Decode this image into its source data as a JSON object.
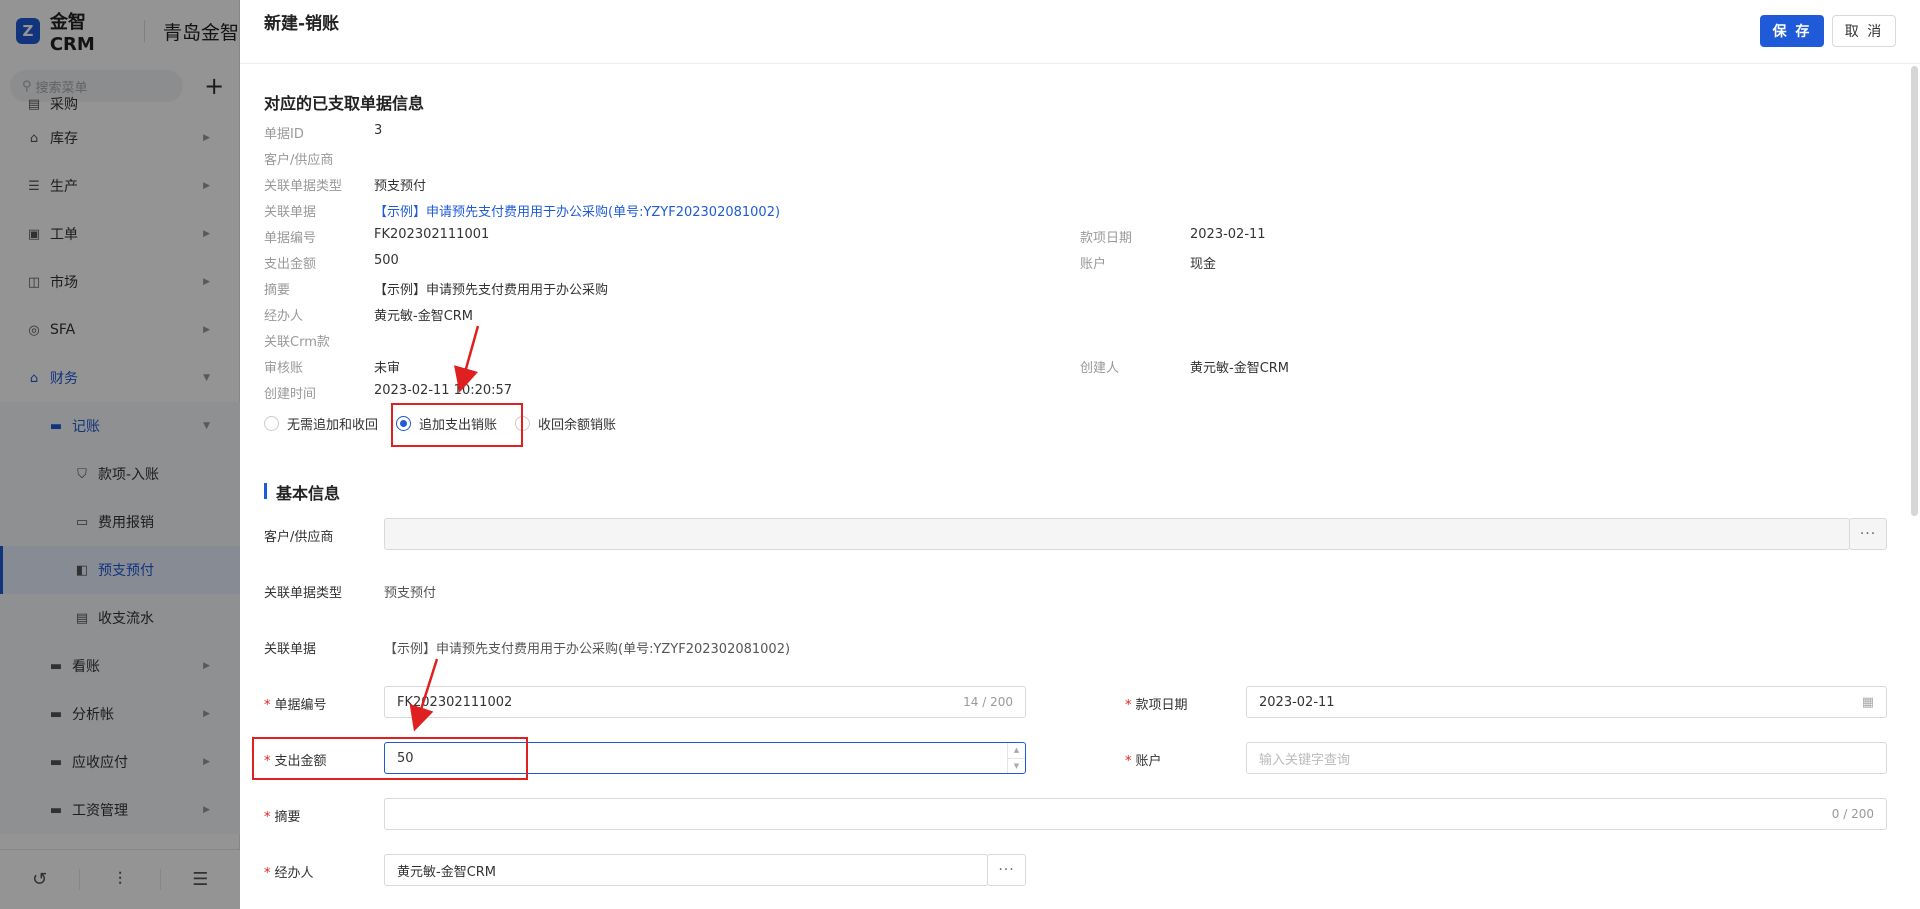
{
  "sidebar": {
    "brand": "金智CRM",
    "company": "青岛金智",
    "search_placeholder": "搜索菜单",
    "menu": [
      {
        "label": "采购",
        "icon": "cart-icon"
      },
      {
        "label": "库存",
        "icon": "warehouse-icon"
      },
      {
        "label": "生产",
        "icon": "production-icon"
      },
      {
        "label": "工单",
        "icon": "workorder-icon"
      },
      {
        "label": "市场",
        "icon": "market-icon"
      },
      {
        "label": "SFA",
        "icon": "sfa-icon"
      },
      {
        "label": "财务",
        "icon": "finance-icon"
      },
      {
        "label": "记账",
        "icon": "folder-icon"
      },
      {
        "label": "款项-入账",
        "icon": "payment-in-icon"
      },
      {
        "label": "费用报销",
        "icon": "expense-icon"
      },
      {
        "label": "预支预付",
        "icon": "prepay-icon"
      },
      {
        "label": "收支流水",
        "icon": "flow-icon"
      },
      {
        "label": "看账",
        "icon": "folder-icon"
      },
      {
        "label": "分析帐",
        "icon": "folder-icon"
      },
      {
        "label": "应收应付",
        "icon": "folder-icon"
      },
      {
        "label": "工资管理",
        "icon": "folder-icon"
      }
    ]
  },
  "drawer": {
    "title": "新建-销账",
    "save_label": "保 存",
    "cancel_label": "取 消"
  },
  "related_info": {
    "title": "对应的已支取单据信息",
    "labels": {
      "doc_id": "单据ID",
      "customer": "客户/供应商",
      "doc_type": "关联单据类型",
      "related_doc": "关联单据",
      "doc_no": "单据编号",
      "amount": "支出金额",
      "summary": "摘要",
      "handler": "经办人",
      "crm_fund": "关联Crm款",
      "audit": "审核账",
      "created_at": "创建时间",
      "fund_date": "款项日期",
      "account": "账户",
      "creator": "创建人"
    },
    "values": {
      "doc_id": "3",
      "doc_type": "预支预付",
      "related_doc": "【示例】申请预先支付费用用于办公采购(单号:YZYF202302081002)",
      "doc_no": "FK202302111001",
      "amount": "500",
      "summary": "【示例】申请预先支付费用用于办公采购",
      "handler": "黄元敏-金智CRM",
      "audit": "未审",
      "created_at": "2023-02-11 10:20:57",
      "fund_date": "2023-02-11",
      "account": "现金",
      "creator": "黄元敏-金智CRM"
    }
  },
  "options": {
    "items": [
      "无需追加和收回",
      "追加支出销账",
      "收回余额销账"
    ],
    "selected": "追加支出销账"
  },
  "basic_info": {
    "title": "基本信息",
    "labels": {
      "customer": "客户/供应商",
      "doc_type": "关联单据类型",
      "related_doc": "关联单据",
      "doc_no": "单据编号",
      "amount": "支出金额",
      "summary": "摘要",
      "handler": "经办人",
      "fund_date": "款项日期",
      "account": "账户"
    },
    "required_mark": "*",
    "values": {
      "doc_type": "预支预付",
      "related_doc": "【示例】申请预先支付费用用于办公采购(单号:YZYF202302081002)",
      "doc_no": "FK202302111002",
      "doc_no_count": "14 / 200",
      "amount": "50",
      "summary_count": "0 / 200",
      "handler": "黄元敏-金智CRM",
      "fund_date": "2023-02-11",
      "account_placeholder": "输入关键字查询",
      "ellipsis": "···"
    }
  },
  "colors": {
    "primary": "#1f5bd8",
    "highlight": "#e02020",
    "required": "#e02020"
  }
}
